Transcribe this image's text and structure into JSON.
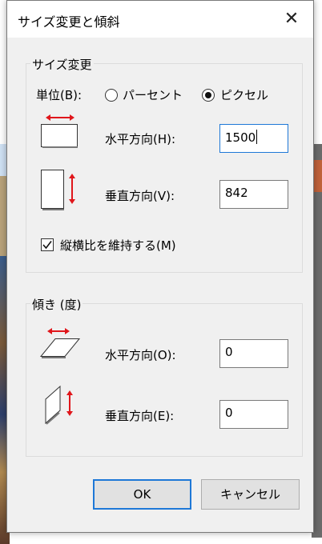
{
  "dialog": {
    "title": "サイズ変更と傾斜",
    "close_glyph": "✕"
  },
  "resize": {
    "group_label": "サイズ変更",
    "unit_label": "単位(B):",
    "unit_options": [
      "パーセント",
      "ピクセル"
    ],
    "unit_selected": "ピクセル",
    "horizontal_label": "水平方向(H):",
    "horizontal_value": "1500",
    "vertical_label": "垂直方向(V):",
    "vertical_value": "842",
    "aspect_label": "縦横比を維持する(M)",
    "aspect_checked": true
  },
  "skew": {
    "group_label": "傾き (度)",
    "horizontal_label": "水平方向(O):",
    "horizontal_value": "0",
    "vertical_label": "垂直方向(E):",
    "vertical_value": "0"
  },
  "buttons": {
    "ok": "OK",
    "cancel": "キャンセル"
  },
  "colors": {
    "arrow": "#e0161b",
    "focus": "#1e78d7"
  }
}
